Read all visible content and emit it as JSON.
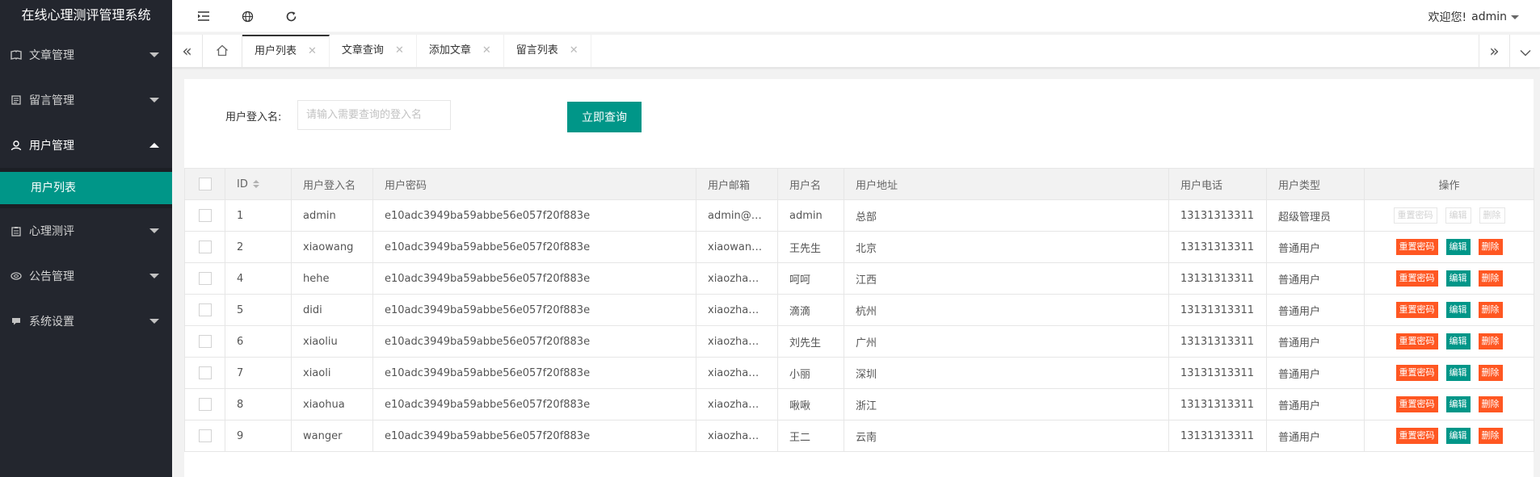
{
  "app": {
    "title": "在线心理测评管理系统"
  },
  "sidebar": {
    "items": [
      {
        "label": "文章管理",
        "icon": "book-icon",
        "open": false
      },
      {
        "label": "留言管理",
        "icon": "message-icon",
        "open": false
      },
      {
        "label": "用户管理",
        "icon": "user-icon",
        "open": true,
        "children": [
          {
            "label": "用户列表",
            "active": true
          }
        ]
      },
      {
        "label": "心理测评",
        "icon": "clipboard-icon",
        "open": false
      },
      {
        "label": "公告管理",
        "icon": "broadcast-icon",
        "open": false
      },
      {
        "label": "系统设置",
        "icon": "settings-icon",
        "open": false
      }
    ]
  },
  "header": {
    "icons": [
      "shrink-menu-icon",
      "globe-icon",
      "refresh-icon"
    ],
    "greeting": "欢迎您!",
    "username": "admin"
  },
  "tabs": [
    {
      "label": "用户列表",
      "active": true
    },
    {
      "label": "文章查询",
      "active": false
    },
    {
      "label": "添加文章",
      "active": false
    },
    {
      "label": "留言列表",
      "active": false
    }
  ],
  "search": {
    "label": "用户登入名:",
    "placeholder": "请输入需要查询的登入名",
    "value": "",
    "button": "立即查询"
  },
  "table": {
    "columns": [
      "ID",
      "用户登入名",
      "用户密码",
      "用户邮箱",
      "用户名",
      "用户地址",
      "用户电话",
      "用户类型",
      "操作"
    ],
    "rows": [
      {
        "id": "1",
        "login": "admin",
        "pwd": "e10adc3949ba59abbe56e057f20f883e",
        "email": "admin@…",
        "name": "admin",
        "addr": "总部",
        "phone": "13131313311",
        "type": "超级管理员",
        "disabled": true
      },
      {
        "id": "2",
        "login": "xiaowang",
        "pwd": "e10adc3949ba59abbe56e057f20f883e",
        "email": "xiaowan…",
        "name": "王先生",
        "addr": "北京",
        "phone": "13131313311",
        "type": "普通用户",
        "disabled": false
      },
      {
        "id": "4",
        "login": "hehe",
        "pwd": "e10adc3949ba59abbe56e057f20f883e",
        "email": "xiaozha…",
        "name": "呵呵",
        "addr": "江西",
        "phone": "13131313311",
        "type": "普通用户",
        "disabled": false
      },
      {
        "id": "5",
        "login": "didi",
        "pwd": "e10adc3949ba59abbe56e057f20f883e",
        "email": "xiaozha…",
        "name": "滴滴",
        "addr": "杭州",
        "phone": "13131313311",
        "type": "普通用户",
        "disabled": false
      },
      {
        "id": "6",
        "login": "xiaoliu",
        "pwd": "e10adc3949ba59abbe56e057f20f883e",
        "email": "xiaozha…",
        "name": "刘先生",
        "addr": "广州",
        "phone": "13131313311",
        "type": "普通用户",
        "disabled": false
      },
      {
        "id": "7",
        "login": "xiaoli",
        "pwd": "e10adc3949ba59abbe56e057f20f883e",
        "email": "xiaozha…",
        "name": "小丽",
        "addr": "深圳",
        "phone": "13131313311",
        "type": "普通用户",
        "disabled": false
      },
      {
        "id": "8",
        "login": "xiaohua",
        "pwd": "e10adc3949ba59abbe56e057f20f883e",
        "email": "xiaozha…",
        "name": "啾啾",
        "addr": "浙江",
        "phone": "13131313311",
        "type": "普通用户",
        "disabled": false
      },
      {
        "id": "9",
        "login": "wanger",
        "pwd": "e10adc3949ba59abbe56e057f20f883e",
        "email": "xiaozha…",
        "name": "王二",
        "addr": "云南",
        "phone": "13131313311",
        "type": "普通用户",
        "disabled": false
      }
    ],
    "actions": {
      "reset": "重置密码",
      "edit": "编辑",
      "delete": "删除"
    }
  },
  "colors": {
    "sidebar_bg": "#23262e",
    "accent": "#009688",
    "warn": "#ff5722"
  }
}
